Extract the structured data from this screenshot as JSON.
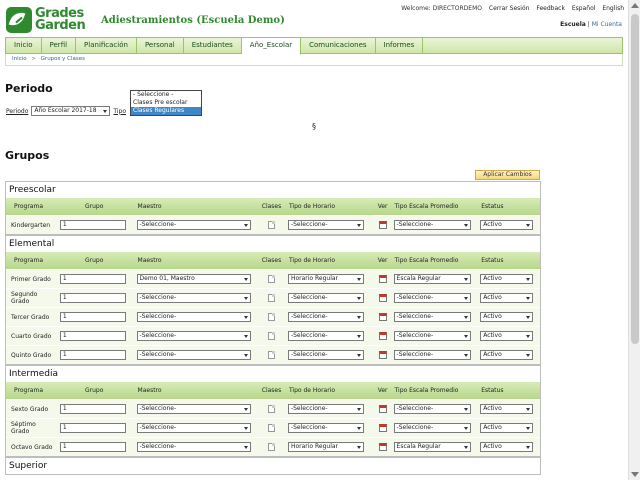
{
  "app": {
    "logo": {
      "line1": "Grades",
      "line2": "Garden"
    },
    "school_title": "Adiestramientos (Escuela Demo)",
    "toplinks": {
      "welcome": "Welcome: DIRECTORDEMO",
      "logout": "Cerrar Sesión",
      "feedback": "Feedback",
      "espanol": "Español",
      "english": "English"
    },
    "escuela_link": "Escuela",
    "sep": "|",
    "mi_cuenta": "Mi Cuenta"
  },
  "nav": {
    "tabs": [
      {
        "label": "Inicio"
      },
      {
        "label": "Perfil"
      },
      {
        "label": "Planificación"
      },
      {
        "label": "Personal"
      },
      {
        "label": "Estudiantes"
      },
      {
        "label": "Año_Escolar"
      },
      {
        "label": "Comunicaciones"
      },
      {
        "label": "Informes"
      }
    ],
    "active_index": 5
  },
  "breadcrumb": {
    "home": "Inicio",
    "arrow": ">",
    "current": "Grupos y Clases"
  },
  "periodo": {
    "title": "Periodo",
    "periodo_label": "Periodo",
    "periodo_value": "Año Escolar 2017-18",
    "tipo_label": "Tipo",
    "tipo_options": [
      "- Seleccione -",
      "Clases Pre escolar",
      "Clases Regulares"
    ],
    "tipo_highlighted_index": 2,
    "section_sign": "§"
  },
  "grupos": {
    "title": "Grupos",
    "apply_label": "Aplicar Cambios",
    "headers": {
      "programa": "Programa",
      "grupo": "Grupo",
      "maestro": "Maestro",
      "clases": "Clases",
      "horario": "Tipo de Horario",
      "ver": "Ver",
      "escala": "Tipo Escala Promedio",
      "estatus": "Estatus"
    },
    "sections": [
      {
        "name": "Preescolar",
        "rows": [
          {
            "programa": "Kindergarten",
            "grupo": "1",
            "maestro": "-Seleccione-",
            "horario": "-Seleccione-",
            "escala": "-Seleccione-",
            "estatus": "Activo"
          }
        ]
      },
      {
        "name": "Elemental",
        "rows": [
          {
            "programa": "Primer Grado",
            "grupo": "1",
            "maestro": "Demo 01, Maestro",
            "horario": "Horario Regular",
            "escala": "Escala Regular",
            "estatus": "Activo"
          },
          {
            "programa": "Segundo Grado",
            "grupo": "1",
            "maestro": "-Seleccione-",
            "horario": "-Seleccione-",
            "escala": "-Seleccione-",
            "estatus": "Activo"
          },
          {
            "programa": "Tercer Grado",
            "grupo": "1",
            "maestro": "-Seleccione-",
            "horario": "-Seleccione-",
            "escala": "-Seleccione-",
            "estatus": "Activo"
          },
          {
            "programa": "Cuarto Grado",
            "grupo": "1",
            "maestro": "-Seleccione-",
            "horario": "-Seleccione-",
            "escala": "-Seleccione-",
            "estatus": "Activo"
          },
          {
            "programa": "Quinto Grado",
            "grupo": "1",
            "maestro": "-Seleccione-",
            "horario": "-Seleccione-",
            "escala": "-Seleccione-",
            "estatus": "Activo"
          }
        ]
      },
      {
        "name": "Intermedia",
        "rows": [
          {
            "programa": "Sexto Grado",
            "grupo": "1",
            "maestro": "-Seleccione-",
            "horario": "-Seleccione-",
            "escala": "-Seleccione-",
            "estatus": "Activo"
          },
          {
            "programa": "Séptimo Grado",
            "grupo": "1",
            "maestro": "-Seleccione-",
            "horario": "-Seleccione-",
            "escala": "-Seleccione-",
            "estatus": "Activo"
          },
          {
            "programa": "Octavo Grado",
            "grupo": "1",
            "maestro": "-Seleccione-",
            "horario": "Horario Regular",
            "escala": "Escala Regular",
            "estatus": "Activo"
          }
        ]
      },
      {
        "name": "Superior",
        "rows": []
      }
    ]
  },
  "icons": {
    "logo": "leaf-icon",
    "clases": "document-icon",
    "ver": "calendar-icon"
  },
  "colors": {
    "brand_green": "#2f8a2f",
    "nav_bg": "#cfe6a8",
    "header_row": "#b6d88a",
    "apply_button": "#f6d87a",
    "highlight": "#3f86c8"
  }
}
